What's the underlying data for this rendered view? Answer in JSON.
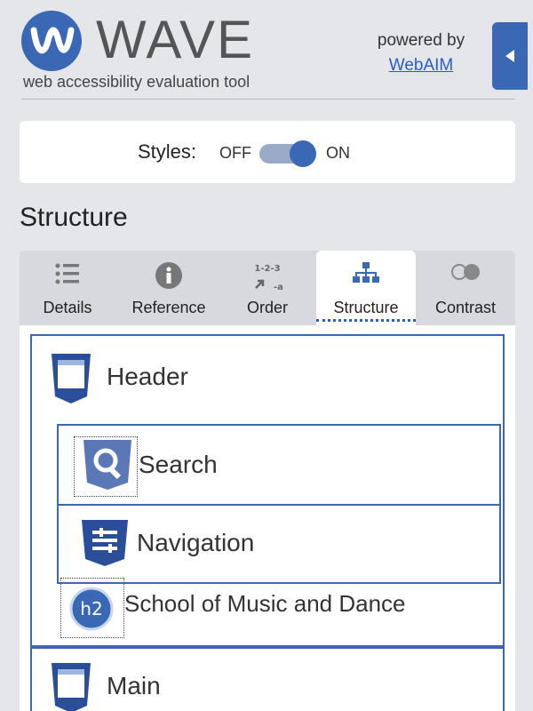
{
  "app": {
    "title": "WAVE",
    "subtitle": "web accessibility evaluation tool",
    "powered_by": "powered by",
    "powered_link": "WebAIM",
    "brand_color": "#3a68b5"
  },
  "styles_toggle": {
    "label": "Styles:",
    "off": "OFF",
    "on": "ON",
    "state": "on"
  },
  "section": {
    "title": "Structure"
  },
  "tabs": [
    {
      "label": "Details",
      "icon": "list-icon",
      "active": false
    },
    {
      "label": "Reference",
      "icon": "info-icon",
      "active": false
    },
    {
      "label": "Order",
      "icon": "order-icon",
      "active": false
    },
    {
      "label": "Structure",
      "icon": "sitemap-icon",
      "active": true
    },
    {
      "label": "Contrast",
      "icon": "contrast-icon",
      "active": false
    }
  ],
  "structure": {
    "header": {
      "label": "Header",
      "icon": "header-region-icon"
    },
    "search": {
      "label": "Search",
      "icon": "search-region-icon"
    },
    "navigation": {
      "label": "Navigation",
      "icon": "navigation-region-icon"
    },
    "heading": {
      "label": "School of Music and Dance",
      "level": "h2",
      "icon": "h2-icon"
    },
    "main": {
      "label": "Main",
      "icon": "main-region-icon"
    }
  },
  "order_icon_text": "1-2-3"
}
